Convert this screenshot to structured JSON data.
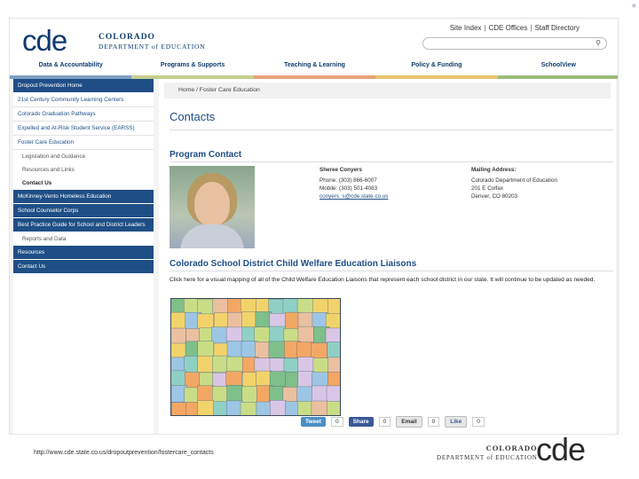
{
  "header": {
    "logo_text": "cde",
    "dept_line1": "COLORADO",
    "dept_line2": "DEPARTMENT of EDUCATION",
    "util_links": [
      "Site Index",
      "CDE Offices",
      "Staff Directory"
    ]
  },
  "nav": {
    "items": [
      "Data & Accountability",
      "Programs & Supports",
      "Teaching & Learning",
      "Policy & Funding",
      "SchoolView"
    ]
  },
  "sidebar": {
    "items": [
      {
        "label": "Dropout Prevention Home",
        "style": "dark"
      },
      {
        "label": "21st Century Community Learning Centers",
        "style": "light"
      },
      {
        "label": "Colorado Graduation Pathways",
        "style": "light"
      },
      {
        "label": "Expelled and At-Risk Student Service (EARSS)",
        "style": "light"
      },
      {
        "label": "Foster Care Education",
        "style": "light"
      }
    ],
    "subitems": [
      "Legislation and Guidance",
      "Resources and Links",
      "Contact Us"
    ],
    "items2": [
      "McKinney-Vento Homeless Education",
      "School Counselor Corps",
      "Best Practice Guide for School and District Leaders"
    ],
    "sub2": "Reports and Data",
    "items3": [
      "Resources",
      "Contact Us"
    ]
  },
  "main": {
    "breadcrumb": "Home / Foster Care Education",
    "page_title": "Contacts",
    "program_contact_title": "Program Contact",
    "contact": {
      "name": "Sheree Conyers",
      "phone": "Phone: (303) 866-6007",
      "mobile": "Mobile: (303) 501-4083",
      "email": "conyers_s@cde.state.co.us"
    },
    "mailing": {
      "head": "Mailing Address:",
      "line1": "Colorado Department of Education",
      "line2": "201 E Colfax",
      "line3": "Denver, CO 80203"
    },
    "liaisons_title": "Colorado School District Child Welfare Education Liaisons",
    "liaisons_intro": "Click here for a visual mapping of all of the Child Welfare Education Liaisons that represent each school district in our state. It will continue to be updated as needed.",
    "share": {
      "tweet": "Tweet",
      "tweet_count": "0",
      "share": "Share",
      "share_count": "0",
      "email": "Email",
      "email_count": "0",
      "like": "Like",
      "like_count": "0"
    },
    "map_colors": [
      "#7fbf8a",
      "#f2d36b",
      "#9cc6e4",
      "#f3a764",
      "#c9dd86",
      "#d9c6e6",
      "#eac0a0",
      "#8fd0c4"
    ]
  },
  "footer": {
    "url": "http://www.cde.state.co.us/dropoutprevention/fostercare_contacts",
    "dept_line1": "COLORADO",
    "dept_line2": "DEPARTMENT of EDUCATION",
    "logo_text": "cde"
  },
  "slide_corner_mark": "*"
}
